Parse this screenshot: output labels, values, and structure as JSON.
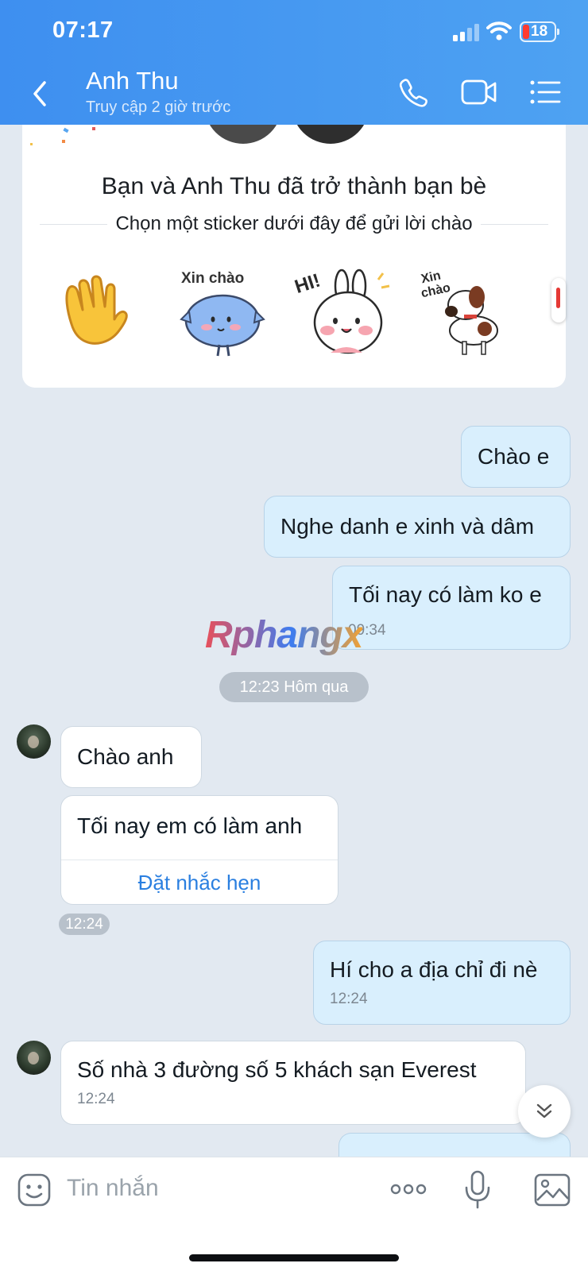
{
  "status_bar": {
    "time": "07:17",
    "battery": "18"
  },
  "header": {
    "contact_name": "Anh Thu",
    "contact_status": "Truy cập 2 giờ trước",
    "icons": [
      "back-icon",
      "phone-icon",
      "video-call-icon",
      "menu-icon"
    ]
  },
  "friend_card": {
    "title": "Bạn và Anh Thu đã trở thành bạn bè",
    "subtitle": "Chọn một sticker dưới đây để gửi lời chào",
    "stickers": [
      {
        "name": "waving-hand-sticker"
      },
      {
        "name": "blue-cat-sticker",
        "text": "Xin chào"
      },
      {
        "name": "white-bunny-sticker",
        "text": "HI!"
      },
      {
        "name": "puppy-sticker",
        "text": "Xin chào"
      }
    ]
  },
  "messages": {
    "out_1": {
      "text": "Chào e"
    },
    "out_2": {
      "text": "Nghe danh e xinh và dâm"
    },
    "out_3": {
      "text": "Tối nay có làm ko e",
      "time": "09:34"
    },
    "divider": "12:23 Hôm qua",
    "in_1": {
      "text": "Chào anh"
    },
    "in_2": {
      "text": "Tối nay em có làm anh",
      "action": "Đặt nhắc hẹn",
      "time": "12:24"
    },
    "out_4": {
      "text": "Hí cho a địa chỉ đi nè",
      "time": "12:24"
    },
    "in_3": {
      "text": "Số nhà 3 đường số 5 khách sạn Everest",
      "time": "12:24"
    }
  },
  "watermark": "Rphangx",
  "input": {
    "placeholder": "Tin nhắn"
  },
  "colors": {
    "header": "#4ea2f2",
    "outgoing_bubble": "#d9effd",
    "incoming_bubble": "#ffffff",
    "background": "#e2e9f1",
    "link": "#2a7fe0"
  }
}
